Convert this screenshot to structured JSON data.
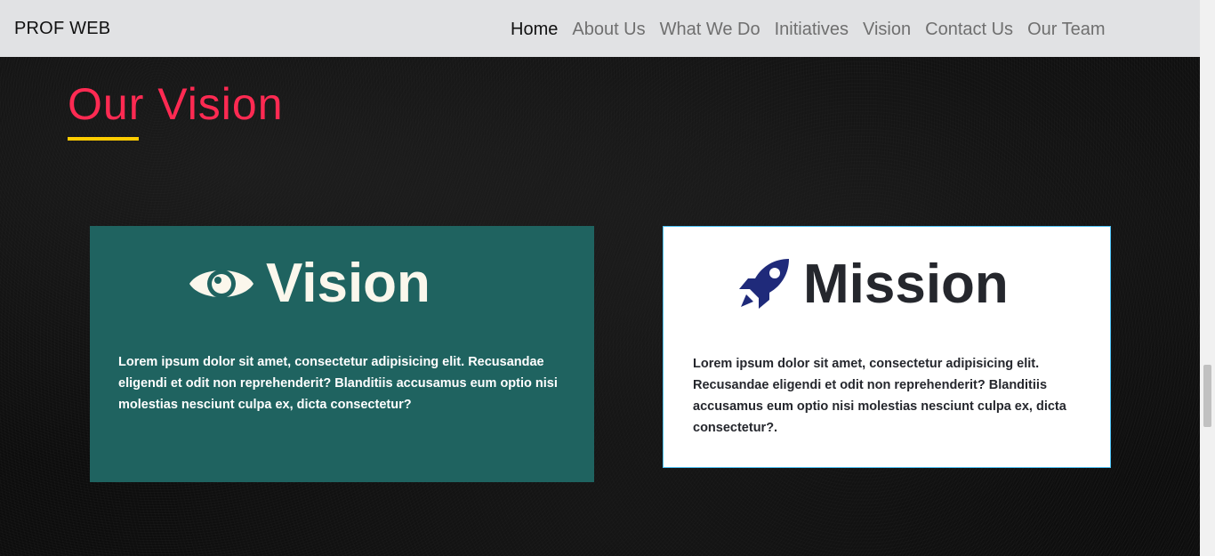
{
  "navbar": {
    "brand": "PROF WEB",
    "links": [
      {
        "label": "Home",
        "active": true
      },
      {
        "label": "About Us"
      },
      {
        "label": "What We Do"
      },
      {
        "label": "Initiatives"
      },
      {
        "label": "Vision"
      },
      {
        "label": "Contact Us"
      },
      {
        "label": "Our Team"
      }
    ]
  },
  "section": {
    "title": "Our Vision",
    "accent_color": "#ff2a52",
    "underline_color": "#ffcc00"
  },
  "cards": {
    "vision": {
      "icon": "eye-icon",
      "title": "Vision",
      "text": "Lorem ipsum dolor sit amet, consectetur adipisicing elit. Recusandae eligendi et odit non reprehenderit? Blanditiis accusamus eum optio nisi molestias nesciunt culpa ex, dicta consectetur?",
      "background": "#1f6360"
    },
    "mission": {
      "icon": "rocket-icon",
      "title": "Mission",
      "text": "Lorem ipsum dolor sit amet, consectetur adipisicing elit. Recusandae eligendi et odit non reprehenderit? Blanditiis accusamus eum optio nisi molestias nesciunt culpa ex, dicta consectetur?.",
      "background": "#ffffff",
      "icon_color": "#1f2a7a"
    }
  }
}
